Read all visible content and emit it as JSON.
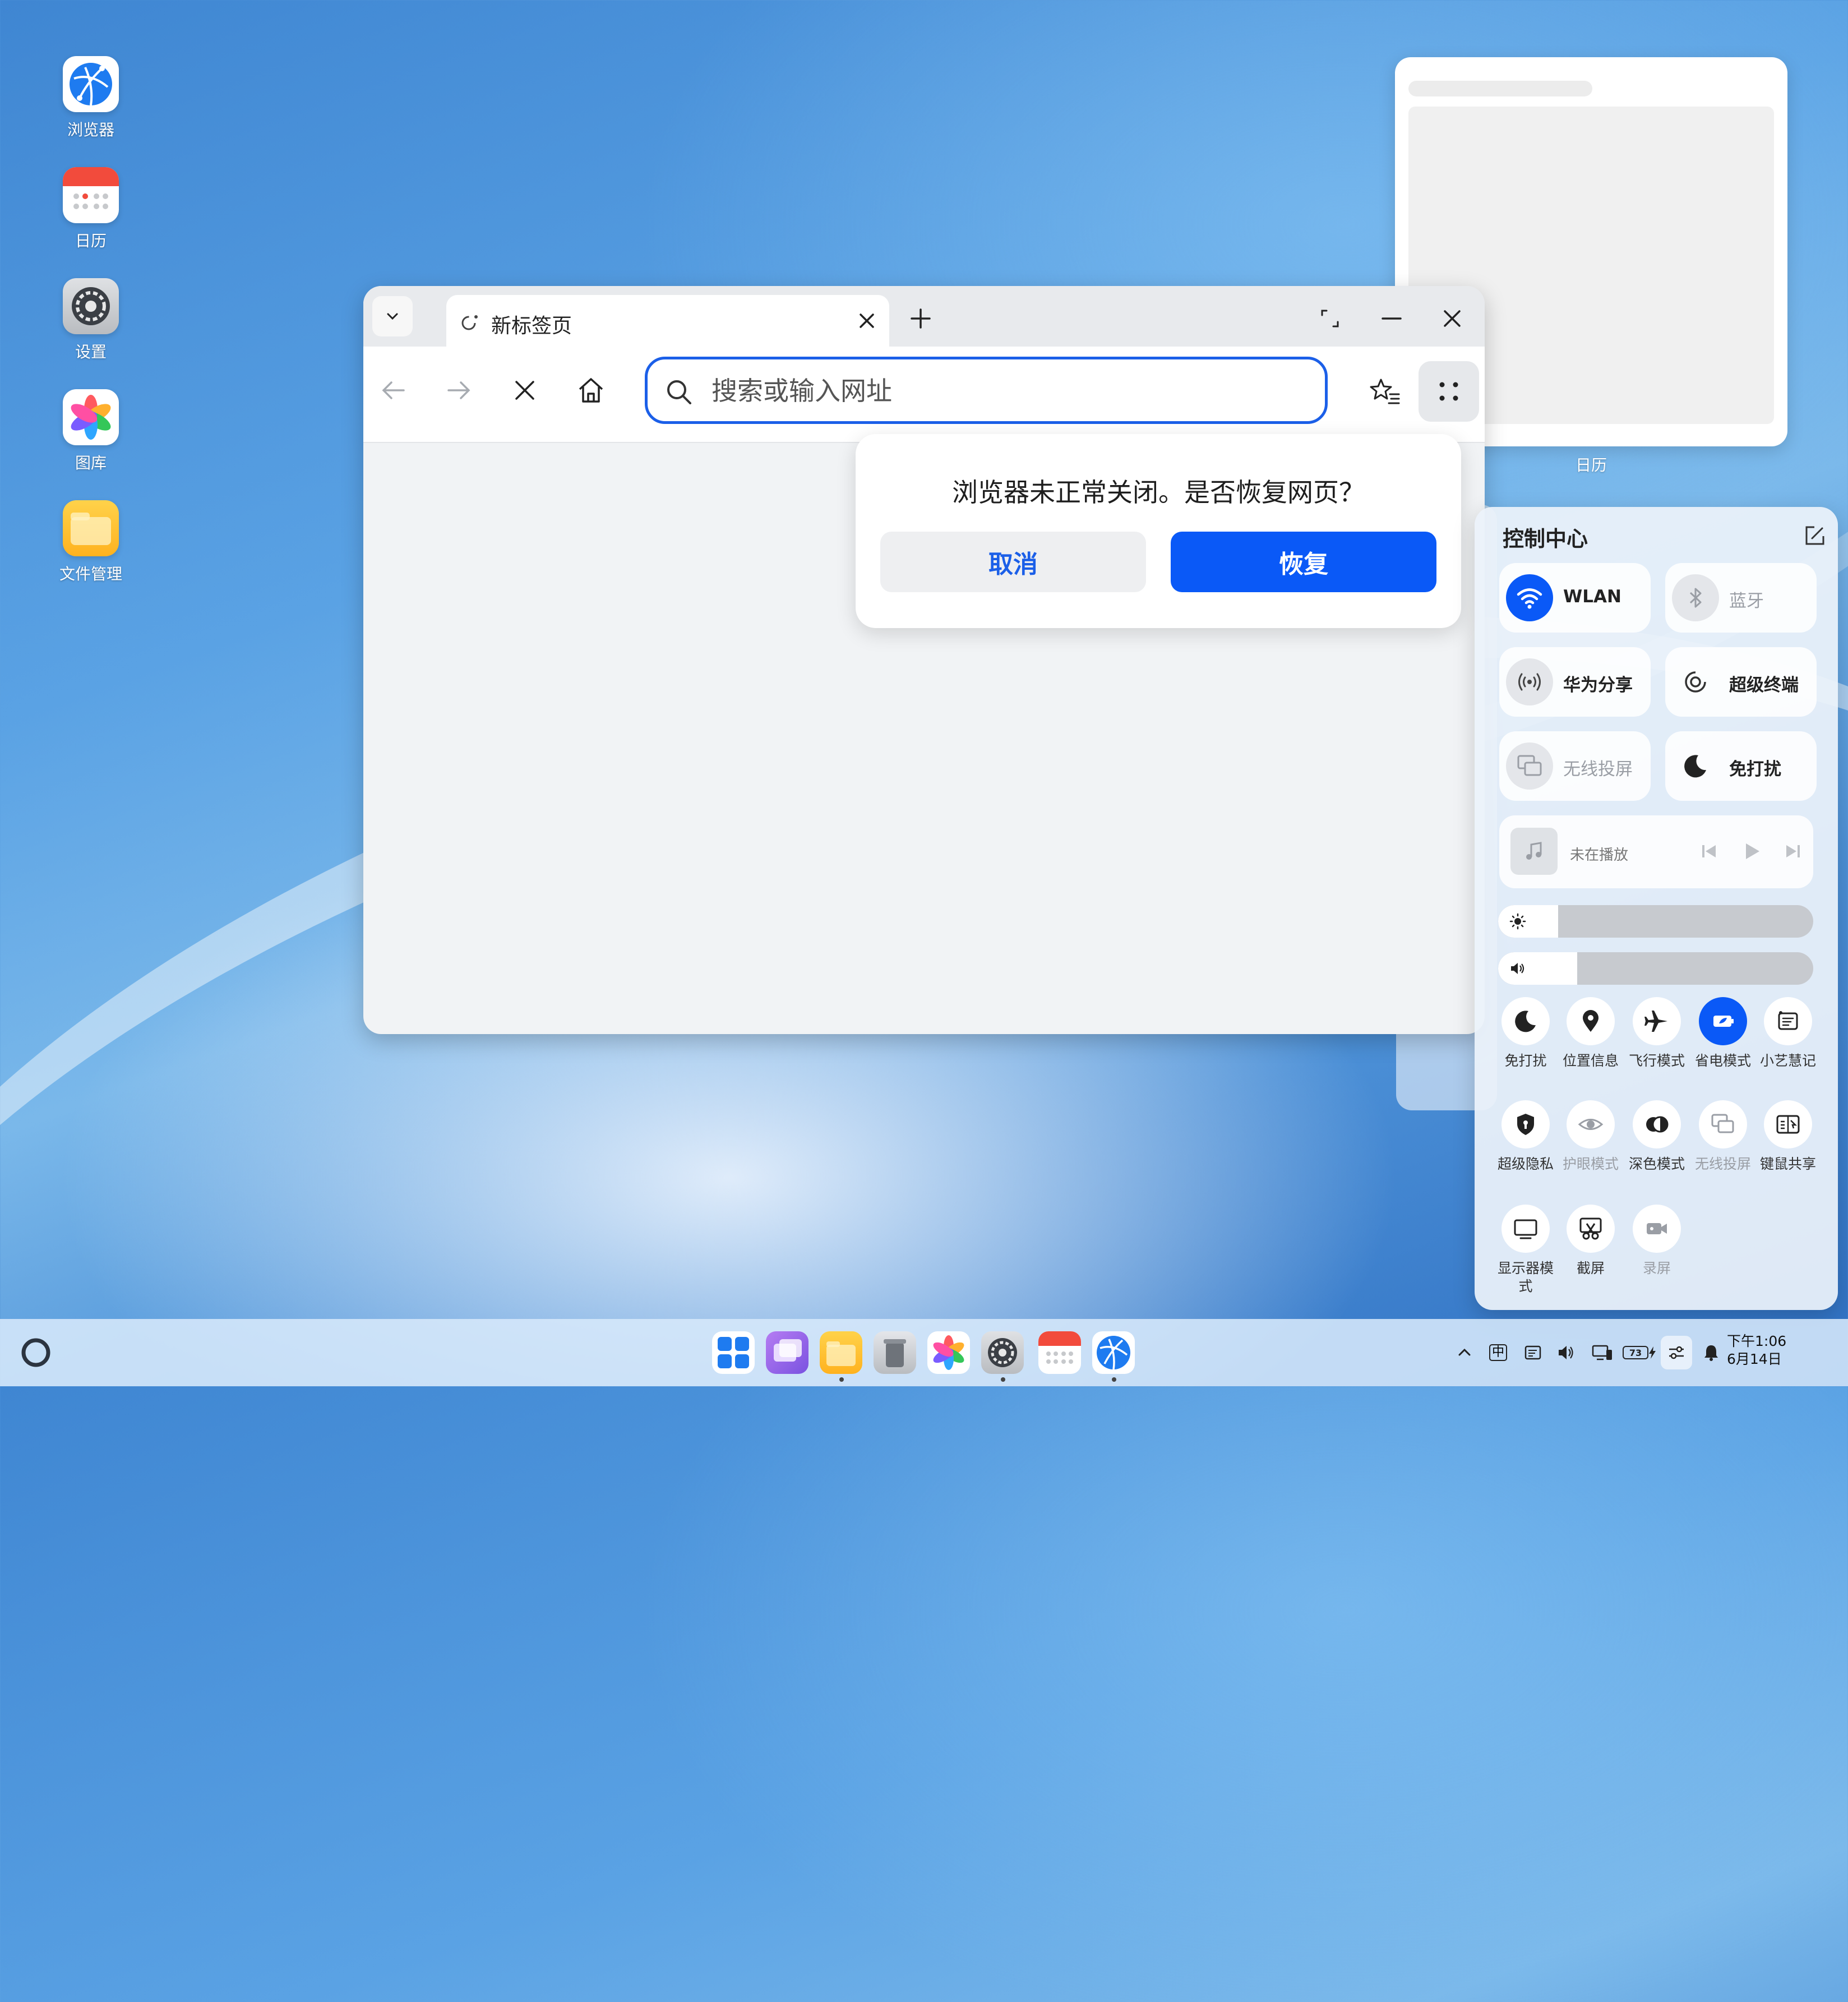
{
  "desktop": {
    "icons": [
      {
        "label": "浏览器"
      },
      {
        "label": "日历"
      },
      {
        "label": "设置"
      },
      {
        "label": "图库"
      },
      {
        "label": "文件管理"
      }
    ]
  },
  "thumbnail": {
    "label": "日历"
  },
  "browser": {
    "tab_title": "新标签页",
    "url_placeholder": "搜索或输入网址"
  },
  "dialog": {
    "message": "浏览器未正常关闭。是否恢复网页？",
    "cancel_label": "取消",
    "confirm_label": "恢复"
  },
  "control_center": {
    "title": "控制中心",
    "tiles": [
      {
        "label": "WLAN",
        "on": true
      },
      {
        "label": "蓝牙",
        "on": false
      },
      {
        "label": "华为分享",
        "on": false
      },
      {
        "label": "超级终端",
        "on": false
      },
      {
        "label": "无线投屏",
        "on": false
      },
      {
        "label": "免打扰",
        "on": false
      }
    ],
    "media": {
      "status": "未在播放"
    },
    "brightness": 0.19,
    "volume": 0.25,
    "quick_row1": [
      {
        "label": "免打扰"
      },
      {
        "label": "位置信息"
      },
      {
        "label": "飞行模式"
      },
      {
        "label": "省电模式",
        "on": true
      },
      {
        "label": "小艺慧记"
      }
    ],
    "quick_row2": [
      {
        "label": "超级隐私"
      },
      {
        "label": "护眼模式"
      },
      {
        "label": "深色模式"
      },
      {
        "label": "无线投屏"
      },
      {
        "label": "键鼠共享"
      }
    ],
    "quick_row3": [
      {
        "label": "显示器模式"
      },
      {
        "label": "截屏"
      },
      {
        "label": "录屏"
      }
    ],
    "accent": "#0a59f7"
  },
  "taskbar": {
    "tray": {
      "ime": "中",
      "battery": "73"
    },
    "clock": {
      "time": "下午1:06",
      "date": "6月14日"
    }
  }
}
